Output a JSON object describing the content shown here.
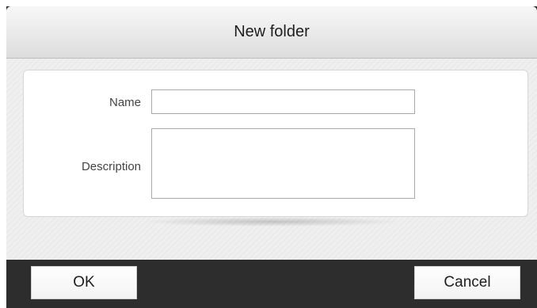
{
  "dialog": {
    "title": "New folder"
  },
  "form": {
    "name_label": "Name",
    "name_value": "",
    "description_label": "Description",
    "description_value": ""
  },
  "buttons": {
    "ok_label": "OK",
    "cancel_label": "Cancel"
  }
}
